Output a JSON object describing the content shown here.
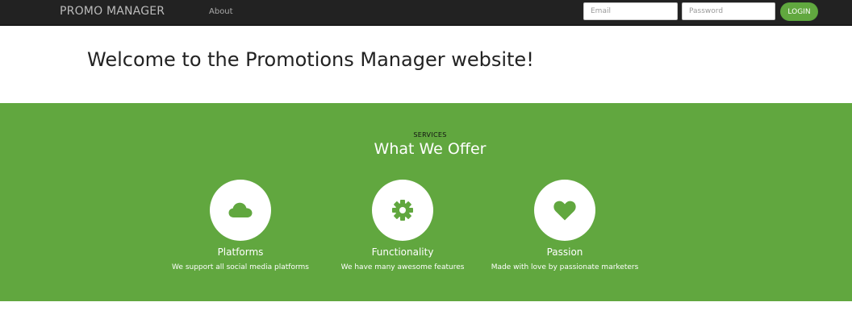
{
  "navbar": {
    "brand": "PROMO MANAGER",
    "about_label": "About",
    "email_placeholder": "Email",
    "password_placeholder": "Password",
    "login_label": "LOGIN"
  },
  "hero": {
    "title": "Welcome to the Promotions Manager website!"
  },
  "services": {
    "eyebrow": "SERVICES",
    "title": "What We Offer",
    "items": [
      {
        "icon": "cloud-icon",
        "title": "Platforms",
        "description": "We support all social media platforms"
      },
      {
        "icon": "gear-icon",
        "title": "Functionality",
        "description": "We have many awesome features"
      },
      {
        "icon": "heart-icon",
        "title": "Passion",
        "description": "Made with love by passionate marketers"
      }
    ]
  },
  "colors": {
    "navbar_bg": "#222222",
    "accent_green": "#61a73f",
    "text_dark": "#222222",
    "white": "#ffffff"
  }
}
